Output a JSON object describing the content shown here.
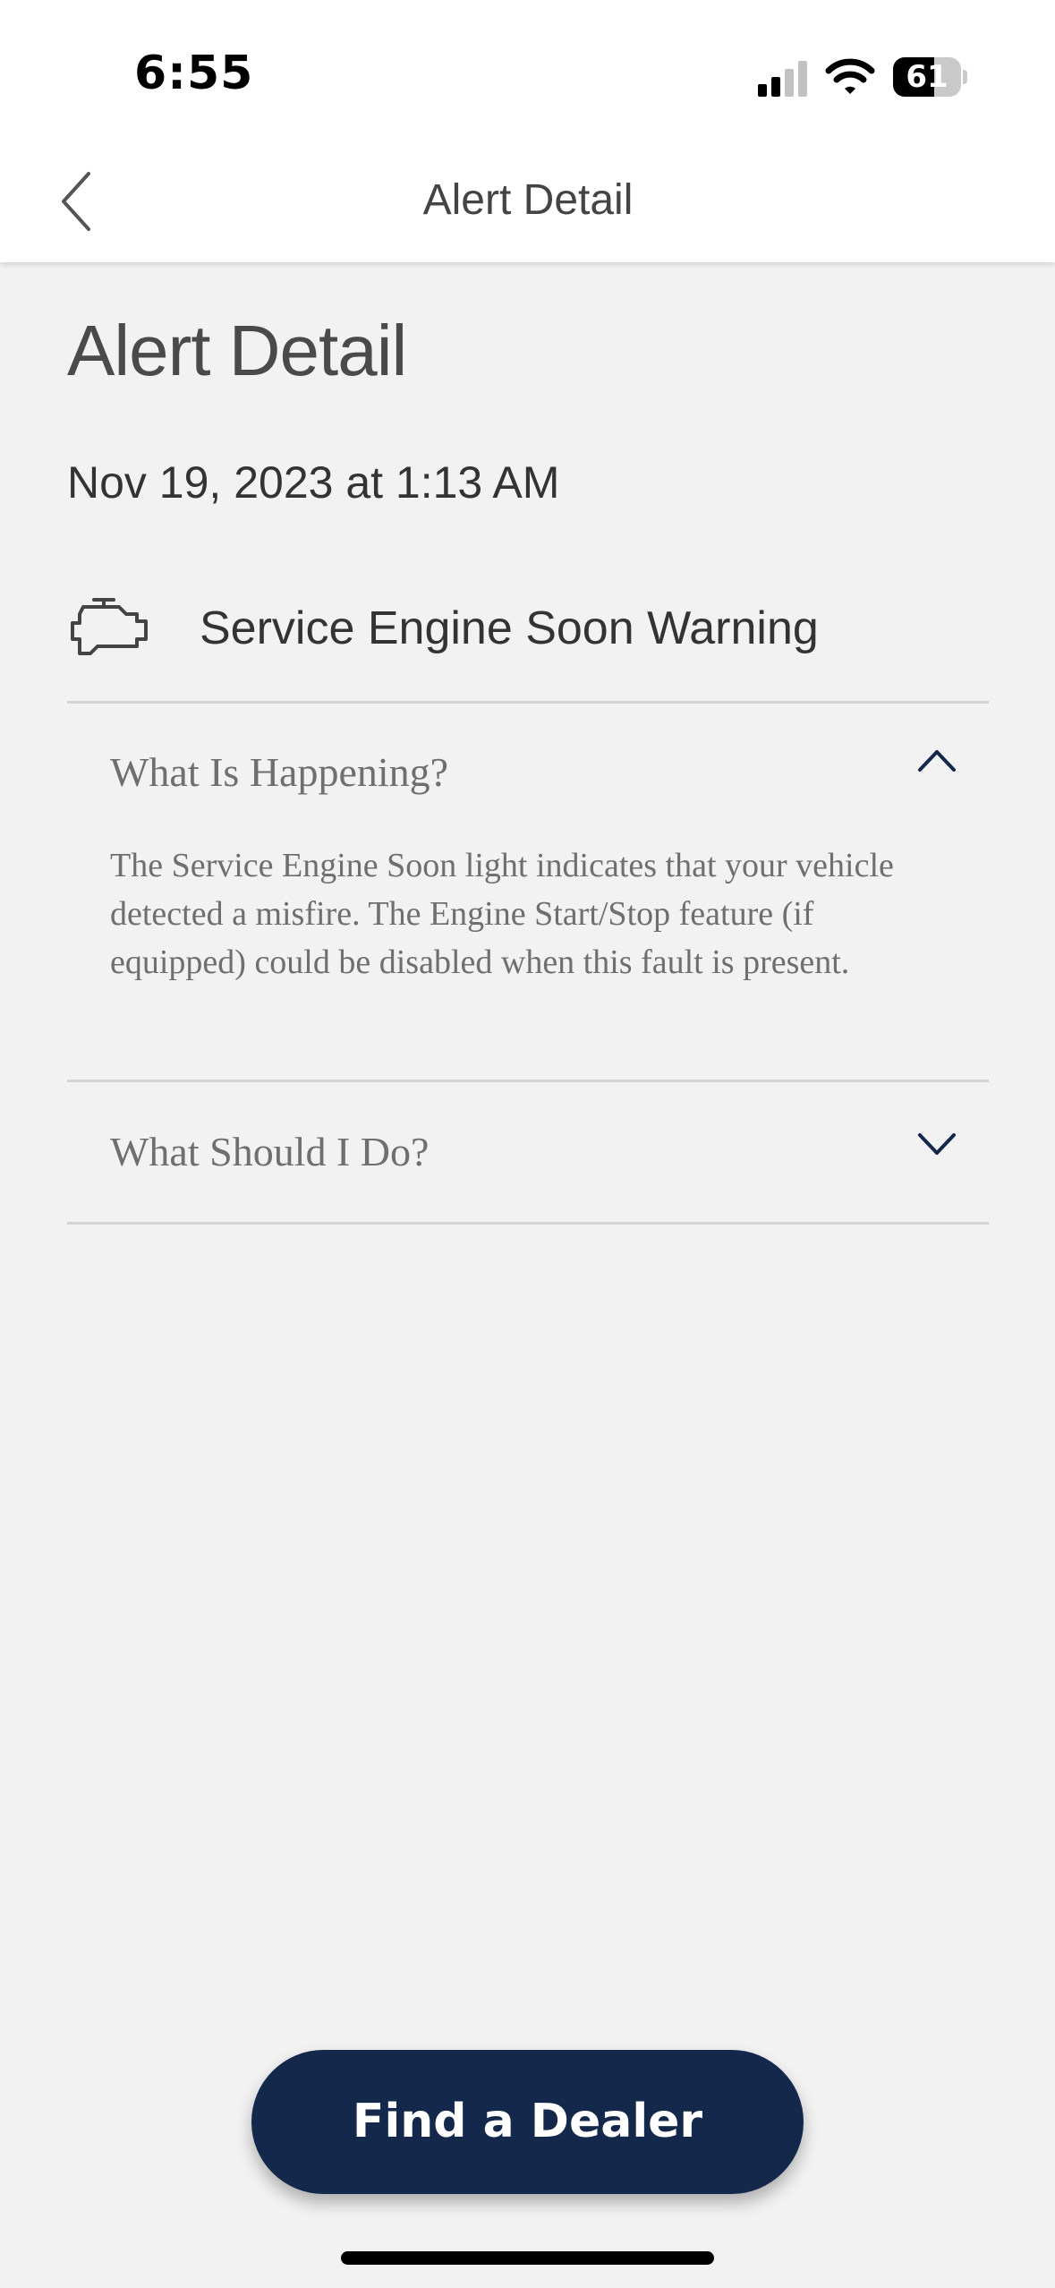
{
  "status_bar": {
    "time": "6:55",
    "battery_level": "61",
    "battery_fraction": 0.61
  },
  "nav": {
    "title": "Alert Detail",
    "back_icon": "chevron-left-icon"
  },
  "page": {
    "title": "Alert Detail",
    "timestamp": "Nov 19, 2023 at 1:13 AM"
  },
  "alert": {
    "icon": "engine-icon",
    "name": "Service Engine Soon Warning"
  },
  "sections": [
    {
      "label": "What Is Happening?",
      "expanded": true,
      "body": "The Service Engine Soon light indicates that your vehicle detected a misfire. The Engine Start/Stop feature (if equipped) could be disabled when this fault is present."
    },
    {
      "label": "What Should I Do?",
      "expanded": false
    }
  ],
  "cta": {
    "label": "Find a Dealer"
  },
  "colors": {
    "primary": "#13284b",
    "background": "#f2f2f2",
    "divider": "#d4d4d4"
  }
}
